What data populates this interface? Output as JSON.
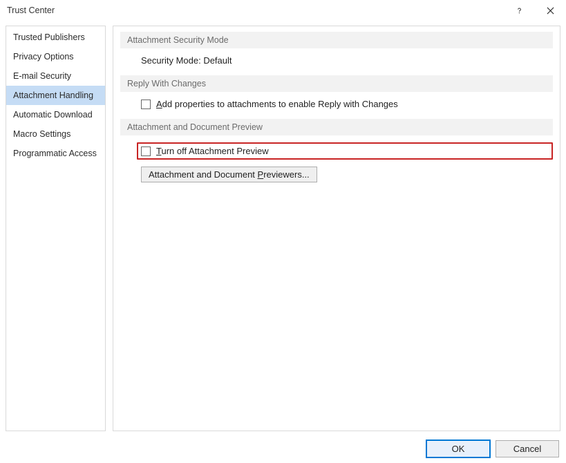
{
  "titlebar": {
    "title": "Trust Center"
  },
  "sidebar": {
    "items": [
      {
        "label": "Trusted Publishers",
        "selected": false
      },
      {
        "label": "Privacy Options",
        "selected": false
      },
      {
        "label": "E-mail Security",
        "selected": false
      },
      {
        "label": "Attachment Handling",
        "selected": true
      },
      {
        "label": "Automatic Download",
        "selected": false
      },
      {
        "label": "Macro Settings",
        "selected": false
      },
      {
        "label": "Programmatic Access",
        "selected": false
      }
    ]
  },
  "main": {
    "sections": {
      "security_mode": {
        "header": "Attachment Security Mode",
        "value": "Security Mode: Default"
      },
      "reply": {
        "header": "Reply With Changes",
        "checkbox_label_pre": "",
        "checkbox_label_u": "A",
        "checkbox_label_post": "dd properties to attachments to enable Reply with Changes"
      },
      "preview": {
        "header": "Attachment and Document Preview",
        "checkbox_label_u": "T",
        "checkbox_label_post": "urn off Attachment Preview",
        "button_label_pre": "Attachment and Document ",
        "button_label_u": "P",
        "button_label_post": "reviewers..."
      }
    }
  },
  "footer": {
    "ok": "OK",
    "cancel": "Cancel"
  }
}
